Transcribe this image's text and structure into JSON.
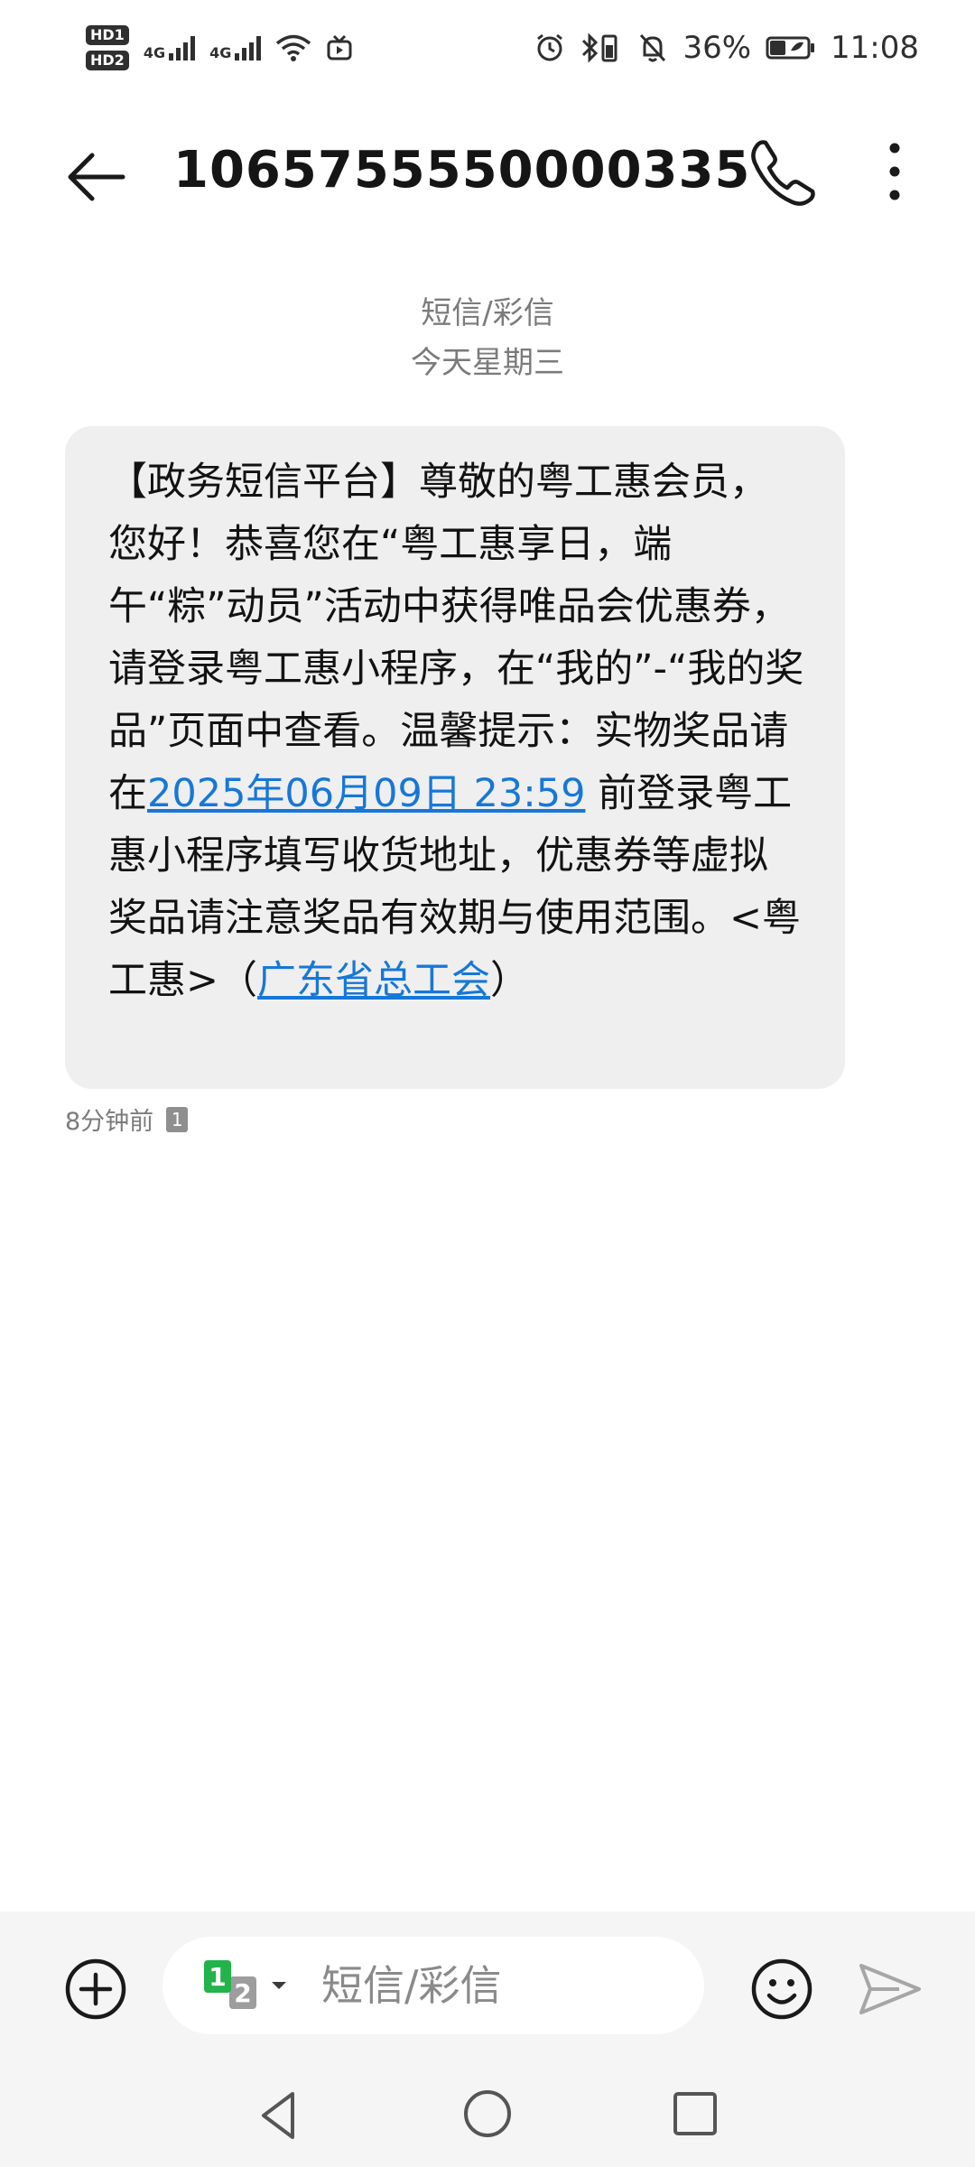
{
  "status_bar": {
    "hd1": "HD1",
    "hd2": "HD2",
    "net1": "4G",
    "net2": "4G",
    "battery": "36%",
    "time": "11:08"
  },
  "header": {
    "contact_number": "1065755550000335",
    "back_icon": "back-arrow-icon",
    "call_icon": "phone-icon",
    "more_icon": "more-vertical-icon"
  },
  "conversation": {
    "channel": "短信/彩信",
    "date": "今天星期三"
  },
  "message": {
    "text_part1": "【政务短信平台】尊敬的粤工惠会员，您好！恭喜您在“粤工惠享日，端午“粽”动员”活动中获得唯品会优惠券，请登录粤工惠小程序，在“我的”-“我的奖品”页面中查看。温馨提示：实物奖品请在",
    "date_link": "2025年06月09日 23:59",
    "text_part2": " 前登录粤工惠小程序填写收货地址，优惠券等虚拟奖品请注意奖品有效期与使用范围。<粤工惠>（",
    "org_link": "广东省总工会",
    "text_part3": "）",
    "time_ago": "8分钟前",
    "sim_slot": "1",
    "link_color": "#1677d8"
  },
  "composer": {
    "sim_primary": "1",
    "sim_secondary": "2",
    "placeholder": "短信/彩信",
    "add_icon": "add-circle-icon",
    "emoji_icon": "emoji-icon",
    "send_icon": "send-icon"
  },
  "navbar": {
    "back_icon": "nav-back-icon",
    "home_icon": "nav-home-icon",
    "recent_icon": "nav-recent-icon"
  }
}
